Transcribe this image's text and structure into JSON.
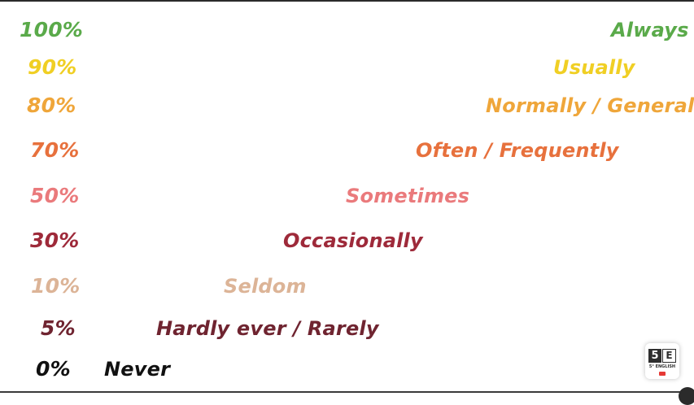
{
  "scale": [
    {
      "percent": "100%",
      "adverb": "Always",
      "color": "#5aaa4a"
    },
    {
      "percent": "90%",
      "adverb": "Usually",
      "color": "#f0cf24"
    },
    {
      "percent": "80%",
      "adverb": "Normally / Generally",
      "color": "#efa63a"
    },
    {
      "percent": "70%",
      "adverb": "Often / Frequently",
      "color": "#e7713d"
    },
    {
      "percent": "50%",
      "adverb": "Sometimes",
      "color": "#ea7a7c"
    },
    {
      "percent": "30%",
      "adverb": "Occasionally",
      "color": "#9e2a3a"
    },
    {
      "percent": "10%",
      "adverb": "Seldom",
      "color": "#dcb497"
    },
    {
      "percent": "5%",
      "adverb": "Hardly ever / Rarely",
      "color": "#6f2430"
    },
    {
      "percent": "0%",
      "adverb": "Never",
      "color": "#111111"
    }
  ],
  "logo": {
    "number": "5",
    "letter": "E",
    "caption": "5° ENGLISH",
    "icon": "play-icon"
  }
}
